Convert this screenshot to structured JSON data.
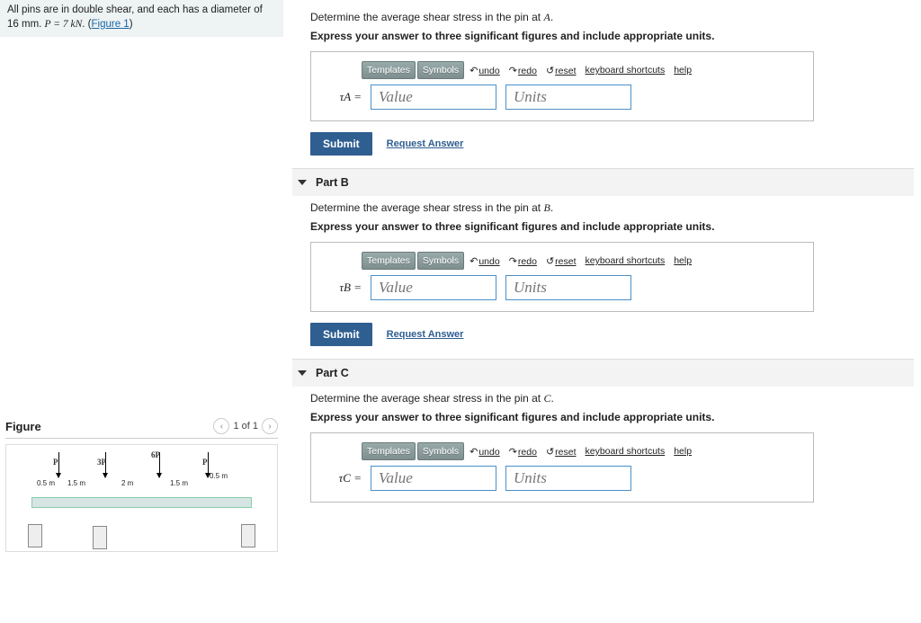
{
  "problem": {
    "text_prefix": "All pins are in double shear, and each has a diameter of 16 mm. ",
    "p_expr": "P = 7 kN",
    "fig_link": "Figure 1"
  },
  "figure": {
    "title": "Figure",
    "counter": "1 of 1",
    "loads": {
      "p1": "P",
      "p2": "3P",
      "p3": "6P",
      "p4": "P"
    },
    "dims": {
      "d1": "0.5 m",
      "d2": "1.5 m",
      "d3": "2 m",
      "d4": "1.5 m",
      "d5": "0.5 m"
    }
  },
  "toolbar": {
    "templates": "Templates",
    "symbols": "Symbols",
    "undo": "undo",
    "redo": "redo",
    "reset": "reset",
    "ks": "keyboard shortcuts",
    "help": "help"
  },
  "common": {
    "value_ph": "Value",
    "units_ph": "Units",
    "submit": "Submit",
    "request": "Request Answer",
    "instr": "Express your answer to three significant figures and include appropriate units."
  },
  "parts": {
    "a": {
      "prompt_prefix": "Determine the average shear stress in the pin at ",
      "var": "A",
      "tau": "τA ="
    },
    "b": {
      "title": "Part B",
      "prompt_prefix": "Determine the average shear stress in the pin at ",
      "var": "B",
      "tau": "τB ="
    },
    "c": {
      "title": "Part C",
      "prompt_prefix": "Determine the average shear stress in the pin at ",
      "var": "C",
      "tau": "τC ="
    }
  }
}
